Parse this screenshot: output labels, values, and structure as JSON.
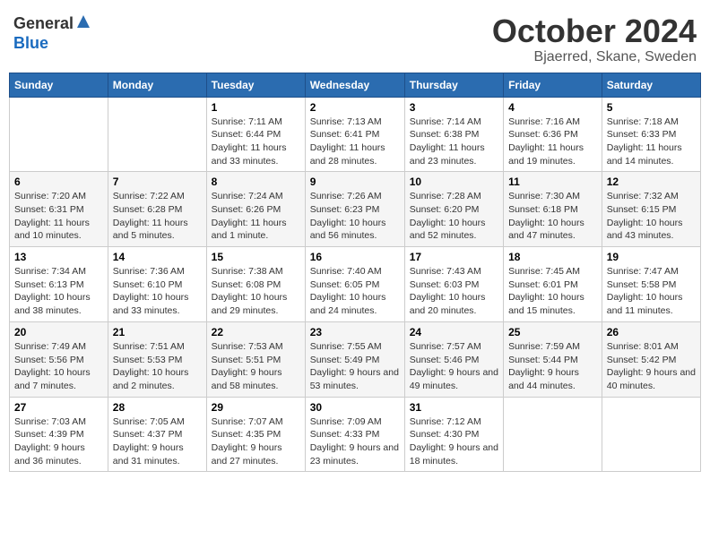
{
  "header": {
    "logo_general": "General",
    "logo_blue": "Blue",
    "month_title": "October 2024",
    "location": "Bjaerred, Skane, Sweden"
  },
  "days_of_week": [
    "Sunday",
    "Monday",
    "Tuesday",
    "Wednesday",
    "Thursday",
    "Friday",
    "Saturday"
  ],
  "weeks": [
    [
      {
        "day": "",
        "info": ""
      },
      {
        "day": "",
        "info": ""
      },
      {
        "day": "1",
        "info": "Sunrise: 7:11 AM\nSunset: 6:44 PM\nDaylight: 11 hours and 33 minutes."
      },
      {
        "day": "2",
        "info": "Sunrise: 7:13 AM\nSunset: 6:41 PM\nDaylight: 11 hours and 28 minutes."
      },
      {
        "day": "3",
        "info": "Sunrise: 7:14 AM\nSunset: 6:38 PM\nDaylight: 11 hours and 23 minutes."
      },
      {
        "day": "4",
        "info": "Sunrise: 7:16 AM\nSunset: 6:36 PM\nDaylight: 11 hours and 19 minutes."
      },
      {
        "day": "5",
        "info": "Sunrise: 7:18 AM\nSunset: 6:33 PM\nDaylight: 11 hours and 14 minutes."
      }
    ],
    [
      {
        "day": "6",
        "info": "Sunrise: 7:20 AM\nSunset: 6:31 PM\nDaylight: 11 hours and 10 minutes."
      },
      {
        "day": "7",
        "info": "Sunrise: 7:22 AM\nSunset: 6:28 PM\nDaylight: 11 hours and 5 minutes."
      },
      {
        "day": "8",
        "info": "Sunrise: 7:24 AM\nSunset: 6:26 PM\nDaylight: 11 hours and 1 minute."
      },
      {
        "day": "9",
        "info": "Sunrise: 7:26 AM\nSunset: 6:23 PM\nDaylight: 10 hours and 56 minutes."
      },
      {
        "day": "10",
        "info": "Sunrise: 7:28 AM\nSunset: 6:20 PM\nDaylight: 10 hours and 52 minutes."
      },
      {
        "day": "11",
        "info": "Sunrise: 7:30 AM\nSunset: 6:18 PM\nDaylight: 10 hours and 47 minutes."
      },
      {
        "day": "12",
        "info": "Sunrise: 7:32 AM\nSunset: 6:15 PM\nDaylight: 10 hours and 43 minutes."
      }
    ],
    [
      {
        "day": "13",
        "info": "Sunrise: 7:34 AM\nSunset: 6:13 PM\nDaylight: 10 hours and 38 minutes."
      },
      {
        "day": "14",
        "info": "Sunrise: 7:36 AM\nSunset: 6:10 PM\nDaylight: 10 hours and 33 minutes."
      },
      {
        "day": "15",
        "info": "Sunrise: 7:38 AM\nSunset: 6:08 PM\nDaylight: 10 hours and 29 minutes."
      },
      {
        "day": "16",
        "info": "Sunrise: 7:40 AM\nSunset: 6:05 PM\nDaylight: 10 hours and 24 minutes."
      },
      {
        "day": "17",
        "info": "Sunrise: 7:43 AM\nSunset: 6:03 PM\nDaylight: 10 hours and 20 minutes."
      },
      {
        "day": "18",
        "info": "Sunrise: 7:45 AM\nSunset: 6:01 PM\nDaylight: 10 hours and 15 minutes."
      },
      {
        "day": "19",
        "info": "Sunrise: 7:47 AM\nSunset: 5:58 PM\nDaylight: 10 hours and 11 minutes."
      }
    ],
    [
      {
        "day": "20",
        "info": "Sunrise: 7:49 AM\nSunset: 5:56 PM\nDaylight: 10 hours and 7 minutes."
      },
      {
        "day": "21",
        "info": "Sunrise: 7:51 AM\nSunset: 5:53 PM\nDaylight: 10 hours and 2 minutes."
      },
      {
        "day": "22",
        "info": "Sunrise: 7:53 AM\nSunset: 5:51 PM\nDaylight: 9 hours and 58 minutes."
      },
      {
        "day": "23",
        "info": "Sunrise: 7:55 AM\nSunset: 5:49 PM\nDaylight: 9 hours and 53 minutes."
      },
      {
        "day": "24",
        "info": "Sunrise: 7:57 AM\nSunset: 5:46 PM\nDaylight: 9 hours and 49 minutes."
      },
      {
        "day": "25",
        "info": "Sunrise: 7:59 AM\nSunset: 5:44 PM\nDaylight: 9 hours and 44 minutes."
      },
      {
        "day": "26",
        "info": "Sunrise: 8:01 AM\nSunset: 5:42 PM\nDaylight: 9 hours and 40 minutes."
      }
    ],
    [
      {
        "day": "27",
        "info": "Sunrise: 7:03 AM\nSunset: 4:39 PM\nDaylight: 9 hours and 36 minutes."
      },
      {
        "day": "28",
        "info": "Sunrise: 7:05 AM\nSunset: 4:37 PM\nDaylight: 9 hours and 31 minutes."
      },
      {
        "day": "29",
        "info": "Sunrise: 7:07 AM\nSunset: 4:35 PM\nDaylight: 9 hours and 27 minutes."
      },
      {
        "day": "30",
        "info": "Sunrise: 7:09 AM\nSunset: 4:33 PM\nDaylight: 9 hours and 23 minutes."
      },
      {
        "day": "31",
        "info": "Sunrise: 7:12 AM\nSunset: 4:30 PM\nDaylight: 9 hours and 18 minutes."
      },
      {
        "day": "",
        "info": ""
      },
      {
        "day": "",
        "info": ""
      }
    ]
  ]
}
